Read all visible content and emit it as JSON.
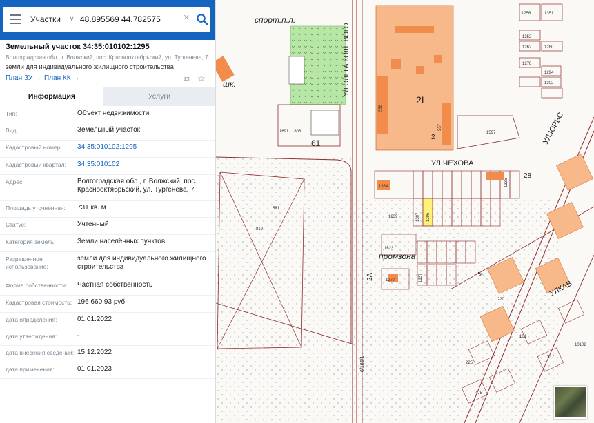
{
  "search": {
    "type_label": "Участки",
    "query": "48.895569 44.782575"
  },
  "object": {
    "title": "Земельный участок 34:35:010102:1295",
    "address_line": "Волгоградская обл., г. Волжский, пос. Краснооктябрьский, ул. Тургенева, 7",
    "purpose_line": "земли для индивидуального жилищного строительства",
    "plan_zu": "План ЗУ →",
    "plan_kk": "План КК →"
  },
  "tabs": {
    "info": "Информация",
    "services": "Услуги"
  },
  "info_rows": [
    {
      "label": "Тип:",
      "value": "Объект недвижимости"
    },
    {
      "label": "Вид:",
      "value": "Земельный участок"
    },
    {
      "label": "Кадастровый номер:",
      "value": "34:35:010102:1295"
    },
    {
      "label": "Кадастровый квартал:",
      "value": "34:35:010102"
    },
    {
      "label": "Адрес:",
      "value": "Волгоградская обл., г. Волжский, пос. Краснооктябрьский, ул. Тургенева, 7"
    },
    {
      "label": "Площадь уточненная:",
      "value": "731 кв. м"
    },
    {
      "label": "Статус:",
      "value": "Учтенный"
    },
    {
      "label": "Категория земель:",
      "value": "Земли населённых пунктов"
    },
    {
      "label": "Разрешенное использование:",
      "value": "земли для индивидуального жилищного строительства"
    },
    {
      "label": "Форма собственности:",
      "value": "Частная собственность"
    },
    {
      "label": "Кадастровая стоимость:",
      "value": "196 660,93 руб."
    },
    {
      "label": "дата определения:",
      "value": "01.01.2022"
    },
    {
      "label": "дата утверждения:",
      "value": "-"
    },
    {
      "label": "дата внесения сведений:",
      "value": "15.12.2022"
    },
    {
      "label": "дата применения:",
      "value": "01.01.2023"
    }
  ],
  "map": {
    "labels": {
      "sport": "спорт.п.л.",
      "shk": "шк.",
      "street_chekhova": "УЛ.ЧЕХОВА",
      "street_uritskogo": "УЛ.ЮРЬС",
      "street_ulkav": "УЛКАВ",
      "promzona": "промзона",
      "street_vertical": "УЛ.ОЛЕГА КОШЕВОГО",
      "road": "6/186/1",
      "num_2": "2",
      "num_2a": "2А",
      "num_4": "4",
      "num_61": "61",
      "num_21": "2I",
      "num_1": "I",
      "num_28": "28"
    },
    "parcels": {
      "p1256": "1256",
      "p1351": "1351",
      "p1352": "1352",
      "p1262": "1262",
      "p1280": "1280",
      "p1278": "1278",
      "p1294": "1294",
      "p1302": "1302",
      "p1597": "1597",
      "p558": "558",
      "p557": "557",
      "p1691": "1691",
      "p1806": "1806",
      "p1334": "1334",
      "p1639": "1639",
      "p581": "581",
      "p819": "819",
      "p1623": "1623",
      "p1277": "1277",
      "p1337": "1337",
      "p1295": "1295",
      "p1335": "1335",
      "p1307": "1307",
      "p101": "101",
      "p220": "220",
      "p225": "225",
      "p475": "475",
      "p10102": "10102",
      "p317": "317"
    }
  },
  "colors": {
    "accent": "#1565c0",
    "industrial": "#f7b98a",
    "park": "#b8e6a7",
    "selected_parcel": "#fff27a"
  }
}
